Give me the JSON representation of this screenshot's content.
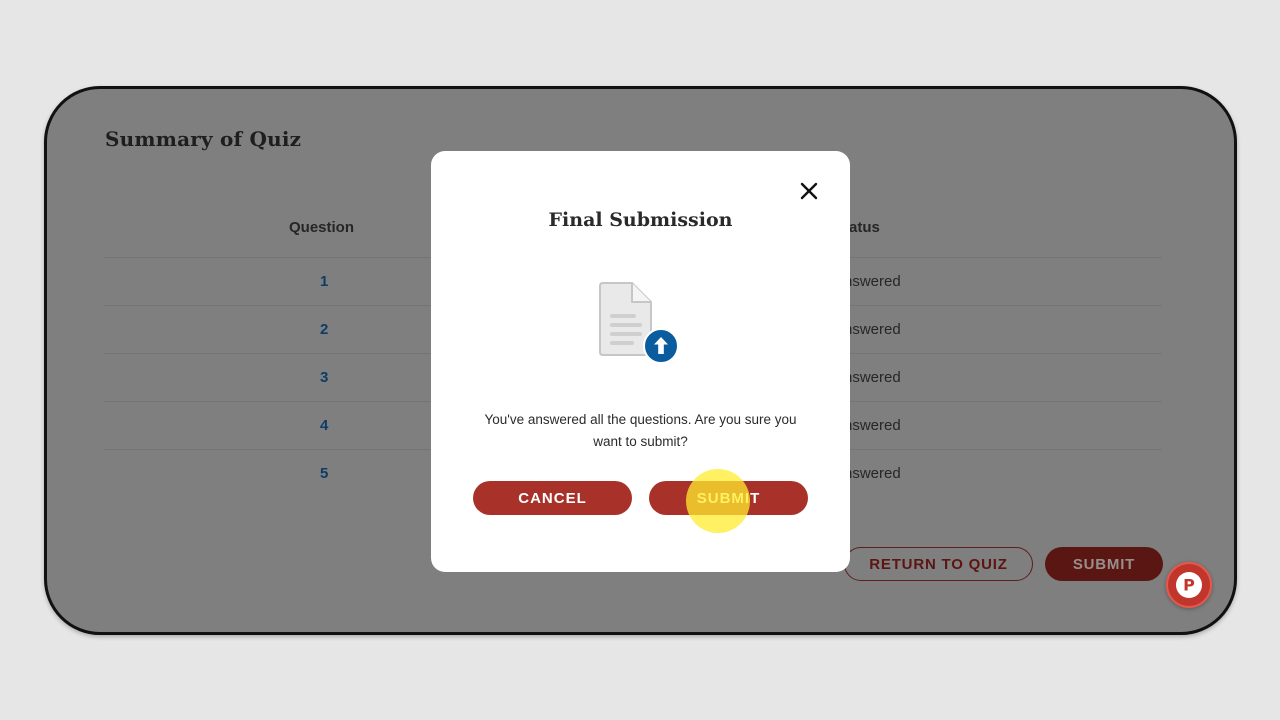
{
  "page": {
    "title": "Summary of Quiz",
    "table": {
      "headers": {
        "question": "Question",
        "status": "Status"
      },
      "rows": [
        {
          "question": "1",
          "status": "Answered"
        },
        {
          "question": "2",
          "status": "Answered"
        },
        {
          "question": "3",
          "status": "Answered"
        },
        {
          "question": "4",
          "status": "Answered"
        },
        {
          "question": "5",
          "status": "Answered"
        }
      ]
    },
    "buttons": {
      "return": "RETURN TO QUIZ",
      "submit": "SUBMIT"
    }
  },
  "modal": {
    "title": "Final Submission",
    "message": "You've answered all the questions. Are you sure you want to submit?",
    "cancel_label": "CANCEL",
    "submit_label": "SUBMIT",
    "close_icon": "close-icon",
    "illustration_icon": "document-upload-icon"
  },
  "help_button": {
    "icon": "help-p-icon",
    "letter": "P"
  },
  "colors": {
    "accent": "#a8322a",
    "accent_dark": "#5a1612",
    "overlay": "#7f7f7f",
    "question_link": "#0d3d66",
    "upload_badge": "#0a5c9e",
    "click_highlight": "#ffec2d"
  }
}
